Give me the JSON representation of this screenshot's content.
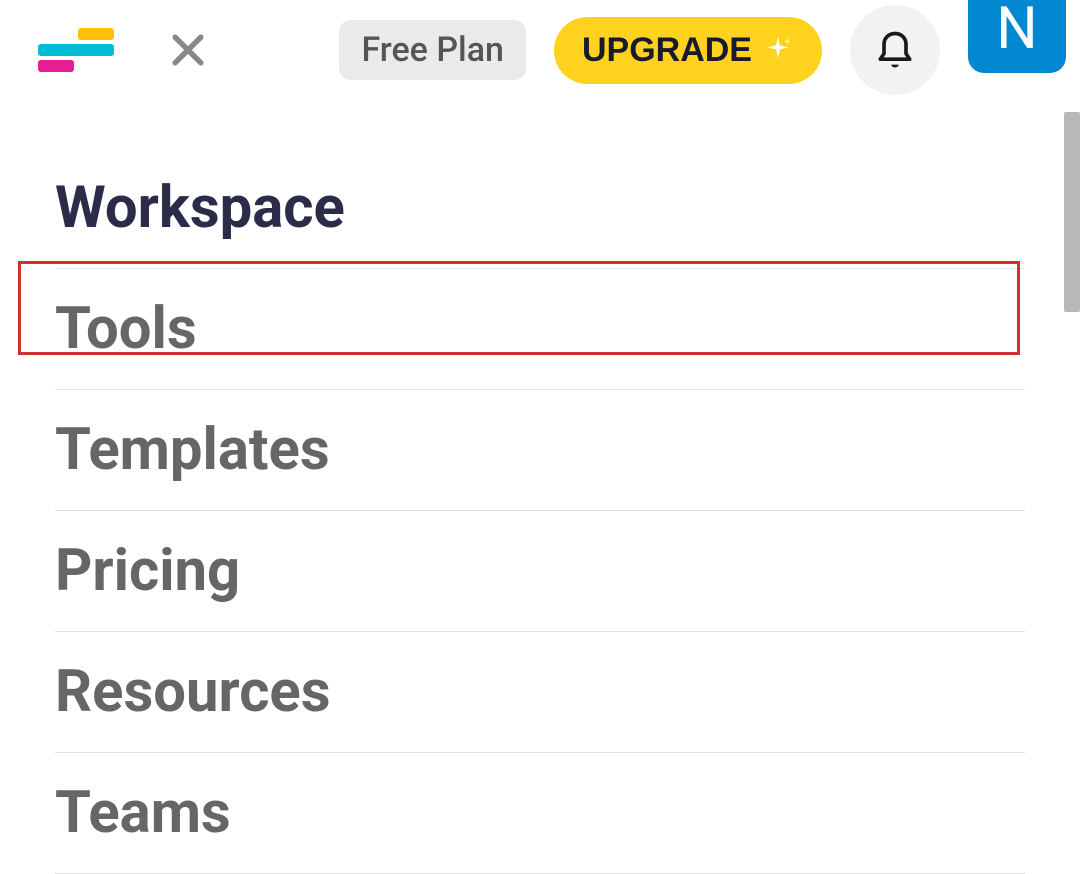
{
  "header": {
    "plan_label": "Free Plan",
    "upgrade_label": "UPGRADE",
    "avatar_initial": "N"
  },
  "menu": {
    "items": [
      {
        "label": "Workspace",
        "active": true
      },
      {
        "label": "Tools",
        "active": false,
        "highlighted": true
      },
      {
        "label": "Templates",
        "active": false
      },
      {
        "label": "Pricing",
        "active": false
      },
      {
        "label": "Resources",
        "active": false
      },
      {
        "label": "Teams",
        "active": false
      }
    ]
  }
}
